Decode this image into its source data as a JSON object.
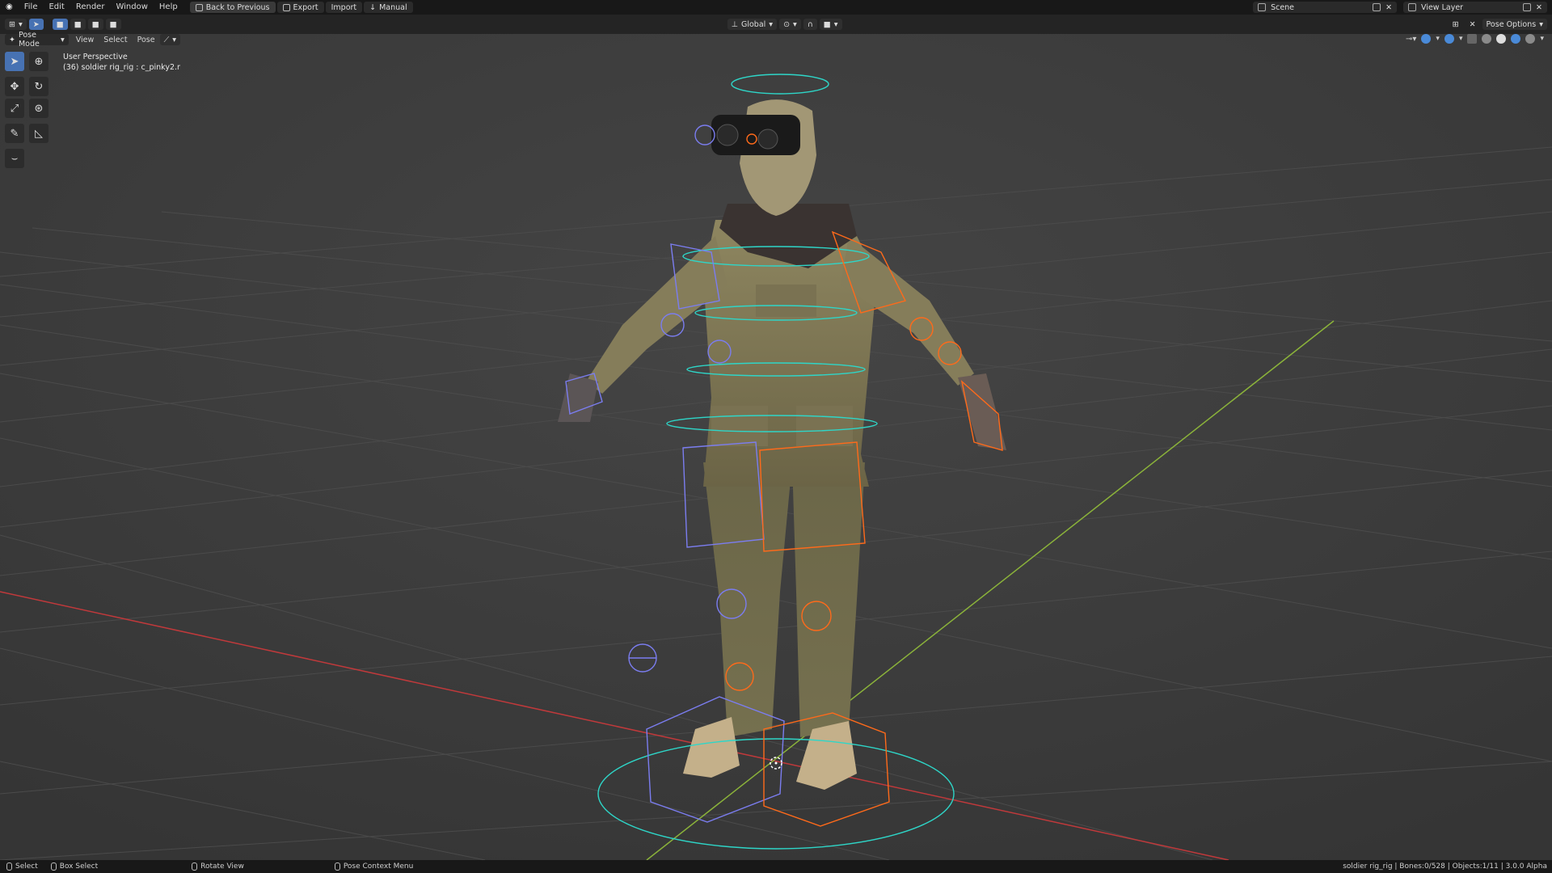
{
  "menu": {
    "items": [
      "File",
      "Edit",
      "Render",
      "Window",
      "Help"
    ],
    "back_to_previous": "Back to Previous",
    "export": "Export",
    "import": "Import",
    "manual": "Manual"
  },
  "scene": {
    "label": "Scene"
  },
  "view_layer": {
    "label": "View Layer"
  },
  "header": {
    "transform_orientation": "Global",
    "pose_options": "Pose Options",
    "mode": "Pose Mode",
    "view": "View",
    "select": "Select",
    "pose": "Pose"
  },
  "viewport": {
    "perspective": "User Perspective",
    "active_bone": "(36) soldier rig_rig : c_pinky2.r"
  },
  "status": {
    "select": "Select",
    "box_select": "Box Select",
    "rotate_view": "Rotate View",
    "context_menu": "Pose Context Menu",
    "info": "soldier rig_rig | Bones:0/528 | Objects:1/11 | 3.0.0 Alpha"
  },
  "colors": {
    "viewport_bg": "#3d3d3d",
    "grid": "#4a4a4a",
    "x_axis": "#c0393b",
    "y_axis": "#8bb33a",
    "rig_cyan": "#2ed6c8",
    "rig_blue": "#7b7df0",
    "rig_orange": "#ff6a1a",
    "accent": "#4772b3"
  }
}
